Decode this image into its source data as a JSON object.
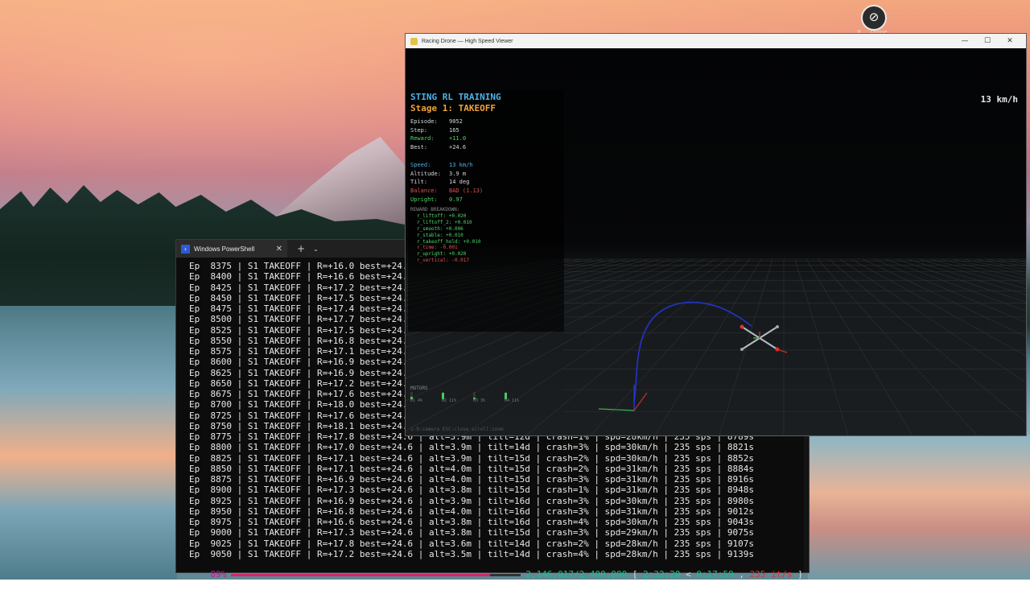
{
  "desktop": {
    "icon_label": "R ... Drone"
  },
  "powershell": {
    "tab_title": "Windows PowerShell",
    "tab_close": "✕",
    "new_tab": "+",
    "dropdown": "⌄",
    "lines": [
      "Ep  8375 | S1 TAKEOFF | R=+16.0 best=+24.",
      "Ep  8400 | S1 TAKEOFF | R=+16.6 best=+24.",
      "Ep  8425 | S1 TAKEOFF | R=+17.2 best=+24.",
      "Ep  8450 | S1 TAKEOFF | R=+17.5 best=+24.",
      "Ep  8475 | S1 TAKEOFF | R=+17.4 best=+24.",
      "Ep  8500 | S1 TAKEOFF | R=+17.7 best=+24.",
      "Ep  8525 | S1 TAKEOFF | R=+17.5 best=+24.",
      "Ep  8550 | S1 TAKEOFF | R=+16.8 best=+24.",
      "Ep  8575 | S1 TAKEOFF | R=+17.1 best=+24.",
      "Ep  8600 | S1 TAKEOFF | R=+16.9 best=+24.",
      "Ep  8625 | S1 TAKEOFF | R=+16.9 best=+24.",
      "Ep  8650 | S1 TAKEOFF | R=+17.2 best=+24.",
      "Ep  8675 | S1 TAKEOFF | R=+17.6 best=+24.",
      "Ep  8700 | S1 TAKEOFF | R=+18.0 best=+24.",
      "Ep  8725 | S1 TAKEOFF | R=+17.6 best=+24.",
      "Ep  8750 | S1 TAKEOFF | R=+18.1 best=+24.",
      "Ep  8775 | S1 TAKEOFF | R=+17.8 best=+24.6 | alt=3.9m | tilt=12d | crash=1% | spd=28km/h | 235 sps | 8789s",
      "Ep  8800 | S1 TAKEOFF | R=+17.0 best=+24.6 | alt=3.9m | tilt=14d | crash=3% | spd=30km/h | 235 sps | 8821s",
      "Ep  8825 | S1 TAKEOFF | R=+17.1 best=+24.6 | alt=3.9m | tilt=15d | crash=2% | spd=30km/h | 235 sps | 8852s",
      "Ep  8850 | S1 TAKEOFF | R=+17.1 best=+24.6 | alt=4.0m | tilt=15d | crash=2% | spd=31km/h | 235 sps | 8884s",
      "Ep  8875 | S1 TAKEOFF | R=+16.9 best=+24.6 | alt=4.0m | tilt=15d | crash=3% | spd=31km/h | 235 sps | 8916s",
      "Ep  8900 | S1 TAKEOFF | R=+17.3 best=+24.6 | alt=3.8m | tilt=15d | crash=1% | spd=31km/h | 235 sps | 8948s",
      "Ep  8925 | S1 TAKEOFF | R=+16.9 best=+24.6 | alt=3.9m | tilt=16d | crash=3% | spd=30km/h | 235 sps | 8980s",
      "Ep  8950 | S1 TAKEOFF | R=+16.8 best=+24.6 | alt=4.0m | tilt=16d | crash=3% | spd=31km/h | 235 sps | 9012s",
      "Ep  8975 | S1 TAKEOFF | R=+16.6 best=+24.6 | alt=3.8m | tilt=16d | crash=4% | spd=30km/h | 235 sps | 9043s",
      "Ep  9000 | S1 TAKEOFF | R=+17.3 best=+24.6 | alt=3.8m | tilt=15d | crash=3% | spd=29km/h | 235 sps | 9075s",
      "Ep  9025 | S1 TAKEOFF | R=+17.8 best=+24.6 | alt=3.6m | tilt=14d | crash=2% | spd=28km/h | 235 sps | 9107s",
      "Ep  9050 | S1 TAKEOFF | R=+17.2 best=+24.6 | alt=3.5m | tilt=14d | crash=4% | spd=28km/h | 235 sps | 9139s"
    ],
    "progress": {
      "percent": "89%",
      "fraction": 0.894,
      "count": "2,146,017/2,400,000",
      "bracket_open": "[",
      "elapsed": "2:32:20",
      "sep": "<",
      "remaining": "0:17:59",
      "comma": ",",
      "rate": "235 it/s",
      "bracket_close": "]"
    }
  },
  "viewer": {
    "title": "Racing Drone — High Speed Viewer",
    "minimize": "—",
    "maximize": "☐",
    "close": "✕",
    "speed_top": "13 km/h",
    "hud": {
      "title": "STING RL TRAINING",
      "stage": "Stage 1: TAKEOFF",
      "rows": [
        {
          "label": "Episode:",
          "value": "9052",
          "color": "#d8d8d8"
        },
        {
          "label": "Step:",
          "value": "165",
          "color": "#d8d8d8"
        },
        {
          "label": "Reward:",
          "value": "+11.0",
          "color": "#4cd964"
        },
        {
          "label": "Best:",
          "value": "+24.6",
          "color": "#d8d8d8"
        }
      ],
      "rows2": [
        {
          "label": "Speed:",
          "value": "13 km/h",
          "color": "#4fb3e9"
        },
        {
          "label": "Altitude:",
          "value": "3.9 m",
          "color": "#d8d8d8"
        },
        {
          "label": "Tilt:",
          "value": "14 deg",
          "color": "#d8d8d8"
        },
        {
          "label": "Balance:",
          "value": "BAD (1.13)",
          "color": "#e0524f"
        },
        {
          "label": "Upright:",
          "value": "0.97",
          "color": "#4cd964"
        }
      ],
      "breakdown_title": "REWARD BREAKDOWN:",
      "breakdown": [
        {
          "text": "r_liftoff: +0.020",
          "color": "#4cd964"
        },
        {
          "text": "r_liftoff_2: +0.010",
          "color": "#4cd964"
        },
        {
          "text": "r_smooth: +0.006",
          "color": "#4cd964"
        },
        {
          "text": "r_stable: +0.010",
          "color": "#4cd964"
        },
        {
          "text": "r_takeoff_hold: +0.010",
          "color": "#4cd964"
        },
        {
          "text": "r_time: -0.001",
          "color": "#e0524f"
        },
        {
          "text": "r_upright: +0.020",
          "color": "#4cd964"
        },
        {
          "text": "r_vertical: -0.017",
          "color": "#e0524f"
        }
      ]
    },
    "motors": {
      "label": "MOTORS",
      "items": [
        {
          "label": "M1 4%",
          "level": 0.04
        },
        {
          "label": "M2 11%",
          "level": 0.11
        },
        {
          "label": "M3 3%",
          "level": 0.03
        },
        {
          "label": "M4 11%",
          "level": 0.11
        }
      ]
    },
    "hint": "1-9:camera  ESC:close  scroll:zoom"
  }
}
